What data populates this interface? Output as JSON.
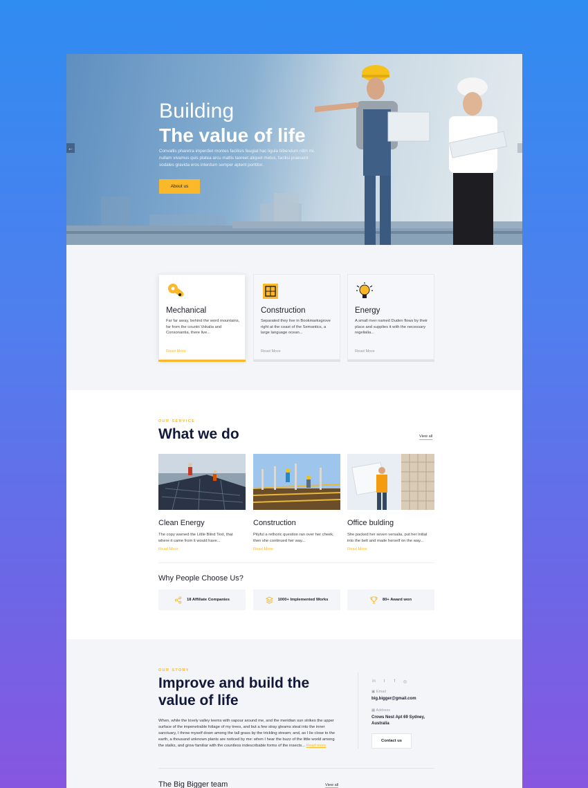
{
  "hero": {
    "title_line1": "Building",
    "title_line2": "The value of life",
    "description": "Convallis pharetra imperdiet montes facilisis feugiat hac ligula bibendum nibh mi, nullam vivamus quis platea arcu mattis laoreet aliquet metus, facilisi praesent sodales gravida eros interdum semper aptent porttitor.",
    "button_label": "About us",
    "prev_arrow": "←"
  },
  "features": [
    {
      "title": "Mechanical",
      "description": "Far far away, behind the word mountains, far from the countri Vokalia and Consonantia, there live...",
      "more": "Read More",
      "icon": "mechanical-gear-icon",
      "active": true
    },
    {
      "title": "Construction",
      "description": "Separated they live in Bookmarksgrove right at the coast of the Semantics, a large language ocean...",
      "more": "Read More",
      "icon": "blueprint-icon",
      "active": false
    },
    {
      "title": "Energy",
      "description": "A small river named Duden flows by their place and supplies it with the necessary regelialia...",
      "more": "Read More",
      "icon": "lightbulb-icon",
      "active": false
    }
  ],
  "services": {
    "eyebrow": "OUR SERVICE",
    "title": "What we do",
    "view_all": "View all",
    "items": [
      {
        "title": "Clean Energy",
        "description": "The copy warned the Little Blind Text, that where it came from it would have...",
        "more": "Read More"
      },
      {
        "title": "Construction",
        "description": "Pityful a rethoric question ran over her cheek, then she continued her way...",
        "more": "Read More"
      },
      {
        "title": "Office bulding",
        "description": "She packed her seven versalia, put her initial into the belt and made herself on the way...",
        "more": "Read More"
      }
    ]
  },
  "why": {
    "title": "Why People Choose Us?",
    "items": [
      {
        "text": "18 Affiliate Companies",
        "icon": "share-icon"
      },
      {
        "text": "1000+ Implemented Works",
        "icon": "layers-icon"
      },
      {
        "text": "80+ Award won",
        "icon": "trophy-icon"
      }
    ]
  },
  "story": {
    "eyebrow": "OUR STORY",
    "title": "Improve and build the value of life",
    "text": "When, while the lovely valley teems with vapour around me, and the meridian sun strikes the upper surface of the impenetrable foliage of my trees, and but a few stray gleams steal into the inner sanctuary, I throw myself down among the tall grass by the trickling stream; and, as I lie close to the earth, a thousand unknown plants are noticed by me: when I hear the buzz of the little world among the stalks, and grow familiar with the countless indescribable forms of the insects...",
    "read_more": "Read more",
    "socials": [
      "in",
      "t",
      "f",
      "◎"
    ],
    "email_label": "Email",
    "email": "big.bigger@gmail.com",
    "address_label": "Address",
    "address": "Crows Nest Apt 69 Sydney, Australia",
    "contact_button": "Contact us"
  },
  "team": {
    "title": "The Big Bigger team",
    "view_all": "View all"
  },
  "colors": {
    "accent": "#fbb829",
    "navy": "#12183a"
  }
}
